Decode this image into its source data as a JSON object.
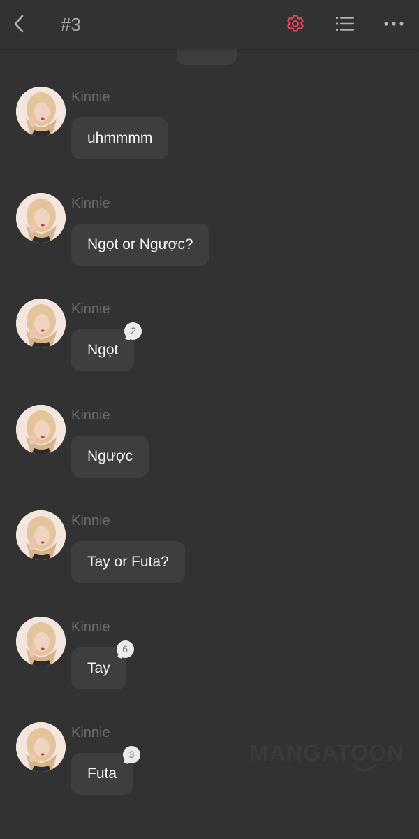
{
  "header": {
    "title": "#3",
    "back_icon": "chevron-left-icon",
    "settings_icon": "gear-icon",
    "list_icon": "list-icon",
    "more_icon": "more-horizontal-icon",
    "accent_color": "#e8435a"
  },
  "messages": [
    {
      "sender": "Kinnie",
      "text": "uhmmmm",
      "count": null
    },
    {
      "sender": "Kinnie",
      "text": "Ngọt or Ngược?",
      "count": null
    },
    {
      "sender": "Kinnie",
      "text": "Ngọt",
      "count": "2"
    },
    {
      "sender": "Kinnie",
      "text": "Ngược",
      "count": null
    },
    {
      "sender": "Kinnie",
      "text": "Tay or Futa?",
      "count": null
    },
    {
      "sender": "Kinnie",
      "text": "Tay",
      "count": "6"
    },
    {
      "sender": "Kinnie",
      "text": "Futa",
      "count": "3"
    }
  ],
  "watermark": {
    "text": "MANGATOON"
  }
}
